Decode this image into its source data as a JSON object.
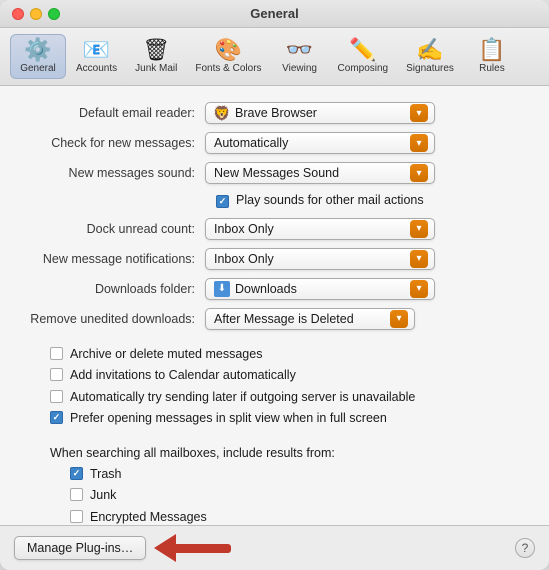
{
  "window": {
    "title": "General"
  },
  "toolbar": {
    "items": [
      {
        "id": "general",
        "label": "General",
        "icon": "⚙️",
        "active": true
      },
      {
        "id": "accounts",
        "label": "Accounts",
        "icon": "📧"
      },
      {
        "id": "junk-mail",
        "label": "Junk Mail",
        "icon": "🗑"
      },
      {
        "id": "fonts-colors",
        "label": "Fonts & Colors",
        "icon": "🎨"
      },
      {
        "id": "viewing",
        "label": "Viewing",
        "icon": "👓"
      },
      {
        "id": "composing",
        "label": "Composing",
        "icon": "✏️"
      },
      {
        "id": "signatures",
        "label": "Signatures",
        "icon": "✍️"
      },
      {
        "id": "rules",
        "label": "Rules",
        "icon": "📋"
      }
    ]
  },
  "form": {
    "default_email_reader": {
      "label": "Default email reader:",
      "value": "Brave Browser",
      "has_icon": true
    },
    "check_for_new_messages": {
      "label": "Check for new messages:",
      "value": "Automatically"
    },
    "new_messages_sound": {
      "label": "New messages sound:",
      "value": "New Messages Sound"
    },
    "play_sounds_label": "Play sounds for other mail actions",
    "dock_unread_count": {
      "label": "Dock unread count:",
      "value": "Inbox Only"
    },
    "new_message_notifications": {
      "label": "New message notifications:",
      "value": "Inbox Only"
    },
    "downloads_folder": {
      "label": "Downloads folder:",
      "value": "Downloads",
      "has_icon": true
    },
    "remove_unedited": {
      "label": "Remove unedited downloads:",
      "value": "After Message is Deleted"
    }
  },
  "checkboxes": {
    "archive_delete": {
      "label": "Archive or delete muted messages",
      "checked": false
    },
    "add_invitations": {
      "label": "Add invitations to Calendar automatically",
      "checked": false
    },
    "auto_retry": {
      "label": "Automatically try sending later if outgoing server is unavailable",
      "checked": false
    },
    "prefer_split_view": {
      "label": "Prefer opening messages in split view when in full screen",
      "checked": true
    }
  },
  "search_section": {
    "label": "When searching all mailboxes, include results from:",
    "items": [
      {
        "id": "trash",
        "label": "Trash",
        "checked": true
      },
      {
        "id": "junk",
        "label": "Junk",
        "checked": false
      },
      {
        "id": "encrypted",
        "label": "Encrypted Messages",
        "checked": false
      }
    ]
  },
  "buttons": {
    "manage_plugins": "Manage Plug-ins…",
    "help": "?"
  }
}
